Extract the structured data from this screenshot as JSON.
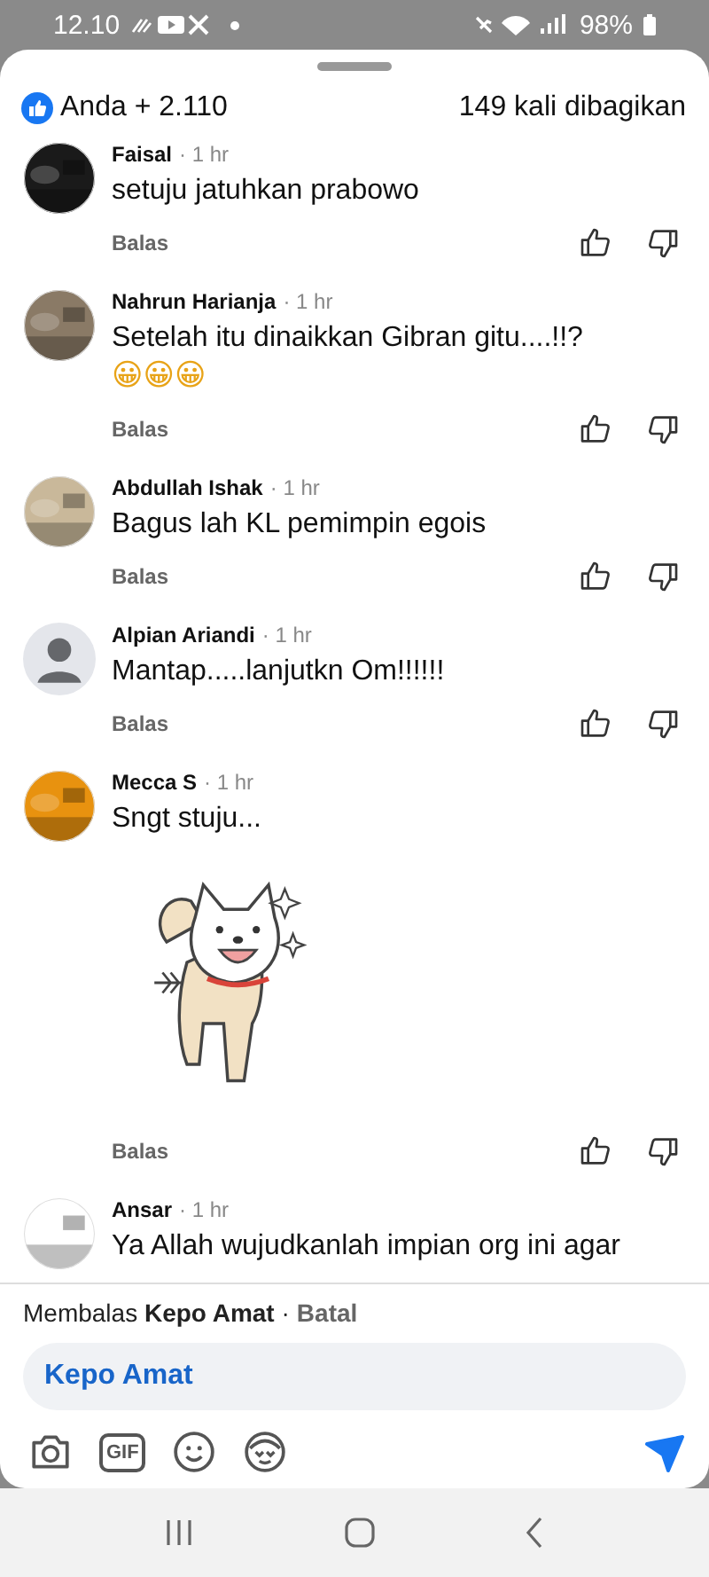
{
  "status_bar": {
    "time": "12.10",
    "battery": "98%"
  },
  "header": {
    "reactions": "Anda + 2.110",
    "shares": "149 kali dibagikan"
  },
  "comments": [
    {
      "name": "Faisal",
      "time": "· 1 hr",
      "text": "setuju jatuhkan prabowo",
      "reply": "Balas"
    },
    {
      "name": "Nahrun Harianja",
      "time": "· 1 hr",
      "text": "Setelah itu dinaikkan Gibran gitu....!!?",
      "emoji": "😀😀😀",
      "reply": "Balas"
    },
    {
      "name": "Abdullah Ishak",
      "time": "· 1 hr",
      "text": "Bagus lah KL pemimpin egois",
      "reply": "Balas"
    },
    {
      "name": "Alpian Ariandi",
      "time": "· 1 hr",
      "text": "Mantap.....lanjutkn Om!!!!!!",
      "reply": "Balas",
      "avatar": {
        "kind": "default"
      }
    },
    {
      "name": "Mecca S",
      "time": "· 1 hr",
      "text": "Sngt stuju...",
      "attachment": {
        "kind": "sticker"
      },
      "reply": "Balas"
    },
    {
      "name": "Ansar",
      "time": "· 1 hr",
      "text": "Ya Allah wujudkanlah impian org ini agar"
    }
  ],
  "composer": {
    "replying": "Membalas **Kepo Amat** ·",
    "cancel": "Batal",
    "value": "Kepo Amat",
    "tools": [
      {
        "kind": "camera"
      },
      {
        "kind": "gif",
        "label": "GIF"
      },
      {
        "kind": "emoji"
      },
      {
        "kind": "avatar"
      }
    ]
  }
}
